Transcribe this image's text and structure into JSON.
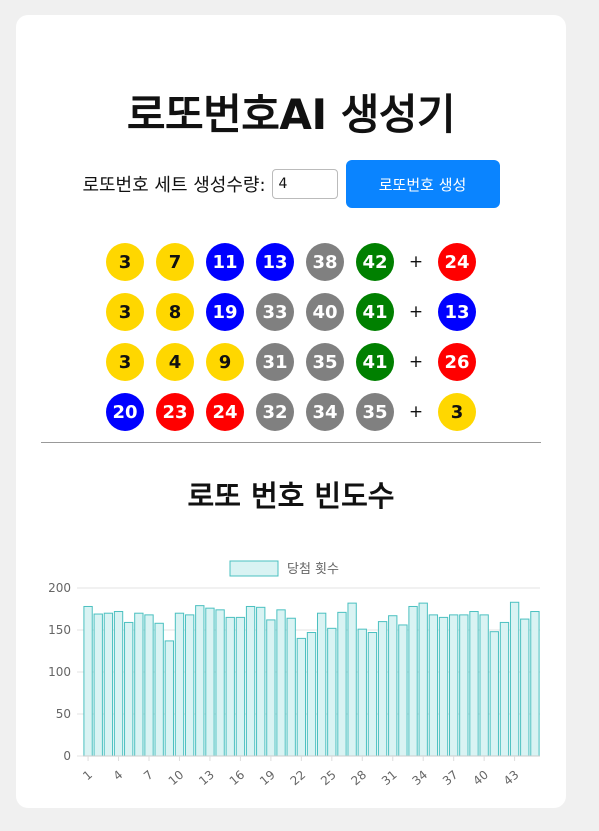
{
  "app": {
    "title": "로또번호AI 생성기",
    "controls": {
      "set_count_label": "로또번호 세트 생성수량:",
      "set_count_value": "4",
      "generate_button": "로또번호 생성"
    },
    "ball_colors": {
      "yellow": "#FFD700",
      "blue": "#0000FF",
      "red": "#FF0000",
      "gray": "#808080",
      "green": "#008000"
    },
    "sets": [
      {
        "numbers": [
          "3",
          "7",
          "11",
          "13",
          "38",
          "42"
        ],
        "plus": "+",
        "bonus": "24"
      },
      {
        "numbers": [
          "3",
          "8",
          "19",
          "33",
          "40",
          "41"
        ],
        "plus": "+",
        "bonus": "13"
      },
      {
        "numbers": [
          "3",
          "4",
          "9",
          "31",
          "35",
          "41"
        ],
        "plus": "+",
        "bonus": "26"
      },
      {
        "numbers": [
          "20",
          "23",
          "24",
          "32",
          "34",
          "35"
        ],
        "plus": "+",
        "bonus": "3"
      }
    ],
    "frequency_title": "로또 번호 빈도수"
  },
  "chart_data": {
    "type": "bar",
    "legend_position": "top-center",
    "grid": true,
    "bar_fill": "#d9f3f3",
    "bar_stroke": "#4bc0c0",
    "ylim": [
      0,
      200
    ],
    "y_ticks": [
      "0",
      "50",
      "100",
      "150",
      "200"
    ],
    "x_tick_labels": [
      "1",
      "4",
      "7",
      "10",
      "13",
      "16",
      "19",
      "22",
      "25",
      "28",
      "31",
      "34",
      "37",
      "40",
      "43"
    ],
    "categories": [
      "1",
      "2",
      "3",
      "4",
      "5",
      "6",
      "7",
      "8",
      "9",
      "10",
      "11",
      "12",
      "13",
      "14",
      "15",
      "16",
      "17",
      "18",
      "19",
      "20",
      "21",
      "22",
      "23",
      "24",
      "25",
      "26",
      "27",
      "28",
      "29",
      "30",
      "31",
      "32",
      "33",
      "34",
      "35",
      "36",
      "37",
      "38",
      "39",
      "40",
      "41",
      "42",
      "43",
      "44",
      "45"
    ],
    "series": [
      {
        "name": "당첨 횟수",
        "values": [
          178,
          169,
          170,
          172,
          159,
          170,
          168,
          158,
          137,
          170,
          168,
          179,
          176,
          174,
          165,
          165,
          178,
          177,
          162,
          174,
          164,
          140,
          147,
          170,
          152,
          171,
          182,
          151,
          147,
          160,
          167,
          156,
          178,
          182,
          168,
          165,
          168,
          168,
          172,
          168,
          148,
          159,
          183,
          163,
          172
        ]
      }
    ]
  }
}
